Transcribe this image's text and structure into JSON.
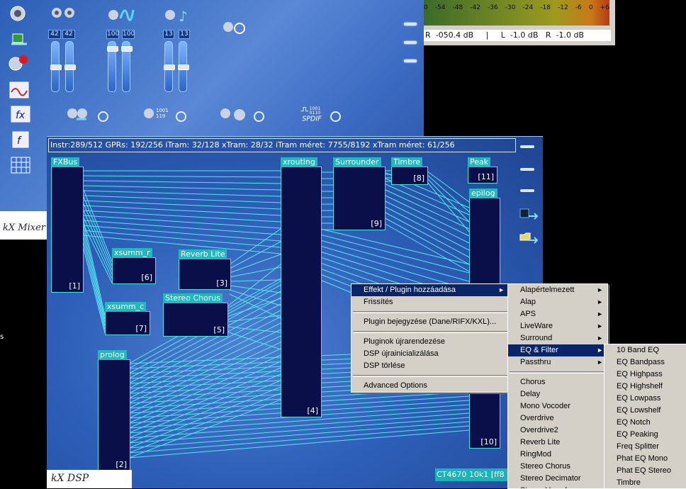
{
  "mixer": {
    "logo": "kX Mixer",
    "levels": [
      {
        "left": "42",
        "right": "42"
      },
      {
        "left": "100",
        "right": "100"
      },
      {
        "left": "13",
        "right": "13"
      }
    ],
    "fader_positions": [
      0.5,
      0.5,
      0.85,
      0.85,
      0.5,
      0.5
    ],
    "spdif_label": "SPDIF",
    "spdif_bits": "1001\n0110",
    "sel_bits": "1001\n119",
    "sidebar_icons": [
      "speaker-settings-icon",
      "routing-icon",
      "record-icon",
      "ac97-icon",
      "fx-icon",
      "function-icon",
      "grid-icon"
    ]
  },
  "vu": {
    "ticks": [
      "0",
      "-54",
      "-48",
      "-42",
      "-36",
      "-30",
      "-24",
      "-18",
      "-12",
      "-6",
      "0",
      "+6"
    ],
    "readout": "R  -050.4 dB     |     L  -1.0 dB   R  -1.0 dB"
  },
  "dsp": {
    "info": "Instr:289/512 GPRs: 192/256 iTram: 32/128 xTram: 28/32 iTram méret: 7755/8192 xTram méret: 61/256",
    "logo": "kX DSP",
    "status": "CT4670 10k1 [ff8",
    "plugins": [
      {
        "name": "FXBus",
        "index": "[1]"
      },
      {
        "name": "prolog",
        "index": "[2]"
      },
      {
        "name": "Stereo Chorus",
        "index": "[5]"
      },
      {
        "name": "xsumm_r",
        "index": "[6]"
      },
      {
        "name": "xsumm_c",
        "index": "[7]"
      },
      {
        "name": "Reverb Lite",
        "index": "[3]"
      },
      {
        "name": "xrouting",
        "index": "[4]"
      },
      {
        "name": "Surrounder",
        "index": "[9]"
      },
      {
        "name": "Timbre",
        "index": "[8]"
      },
      {
        "name": "Peak",
        "index": "[11]"
      },
      {
        "name": "epilog",
        "index": "[10]"
      }
    ]
  },
  "context_menu": {
    "items": [
      {
        "label": "Effekt / Plugin hozzáadása",
        "submenu": true,
        "selected": true
      },
      {
        "label": "Frissítés"
      },
      {
        "sep": true
      },
      {
        "label": "Plugin bejegyzése (Dane/RIFX/KXL)..."
      },
      {
        "sep": true
      },
      {
        "label": "Pluginok újrarendezése"
      },
      {
        "label": "DSP újrainicializálása"
      },
      {
        "label": "DSP törlése"
      },
      {
        "sep": true
      },
      {
        "label": "Advanced Options"
      }
    ]
  },
  "category_menu": {
    "items": [
      {
        "label": "Alapértelmezett",
        "submenu": true
      },
      {
        "label": "Alap",
        "submenu": true
      },
      {
        "label": "APS",
        "submenu": true
      },
      {
        "label": "LiveWare",
        "submenu": true
      },
      {
        "label": "Surround",
        "submenu": true
      },
      {
        "label": "EQ & Filter",
        "submenu": true,
        "selected": true
      },
      {
        "label": "Passthru",
        "submenu": true
      },
      {
        "sep": true
      },
      {
        "label": "Chorus"
      },
      {
        "label": "Delay"
      },
      {
        "label": "Mono Vocoder"
      },
      {
        "label": "Overdrive"
      },
      {
        "label": "Overdrive2"
      },
      {
        "label": "Reverb Lite"
      },
      {
        "label": "RingMod"
      },
      {
        "label": "Stereo Chorus"
      },
      {
        "label": "Stereo Decimator"
      },
      {
        "label": "Stereo Vocoder"
      }
    ]
  },
  "eq_menu": {
    "items": [
      {
        "label": "10 Band EQ"
      },
      {
        "label": "EQ Bandpass"
      },
      {
        "label": "EQ Highpass"
      },
      {
        "label": "EQ Highshelf"
      },
      {
        "label": "EQ Lowpass"
      },
      {
        "label": "EQ Lowshelf"
      },
      {
        "label": "EQ Notch"
      },
      {
        "label": "EQ Peaking"
      },
      {
        "label": "Freq Splitter"
      },
      {
        "label": "Phat EQ Mono"
      },
      {
        "label": "Phat EQ Stereo"
      },
      {
        "label": "Timbre"
      }
    ]
  },
  "left_edge_glyph": "s"
}
